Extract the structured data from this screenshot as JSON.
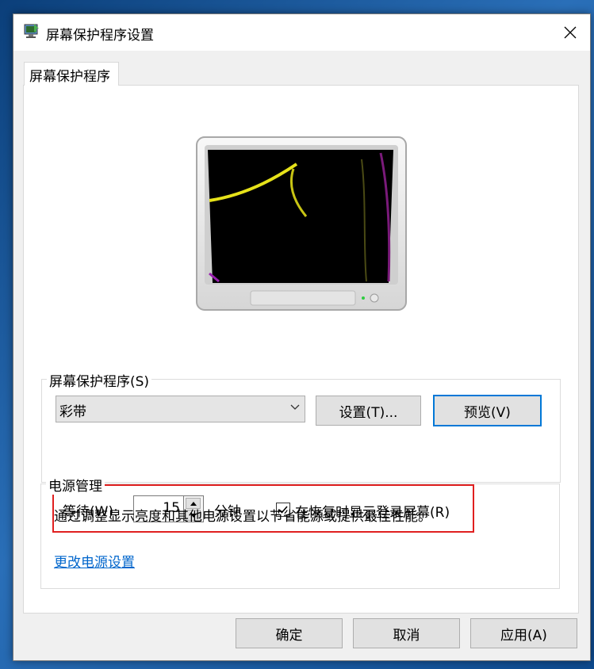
{
  "window": {
    "title": "屏幕保护程序设置",
    "icon": "screensaver-settings-icon",
    "close_icon": "close-icon"
  },
  "tabs": [
    {
      "label": "屏幕保护程序",
      "selected": true
    }
  ],
  "screensaver": {
    "group_label": "屏幕保护程序(S)",
    "selected": "彩带",
    "settings_button": "设置(T)...",
    "preview_button": "预览(V)",
    "wait_label": "等待(W):",
    "wait_value": "15",
    "wait_unit": "分钟",
    "resume_checkbox_label": "在恢复时显示登录屏幕(R)",
    "resume_checked": true
  },
  "power": {
    "group_label": "电源管理",
    "description": "通过调整显示亮度和其他电源设置以节省能源或提供最佳性能。",
    "link": "更改电源设置"
  },
  "footer": {
    "ok": "确定",
    "cancel": "取消",
    "apply": "应用(A)"
  },
  "colors": {
    "accent": "#0078d7",
    "highlight_box": "#e02020",
    "link": "#0066cc"
  }
}
